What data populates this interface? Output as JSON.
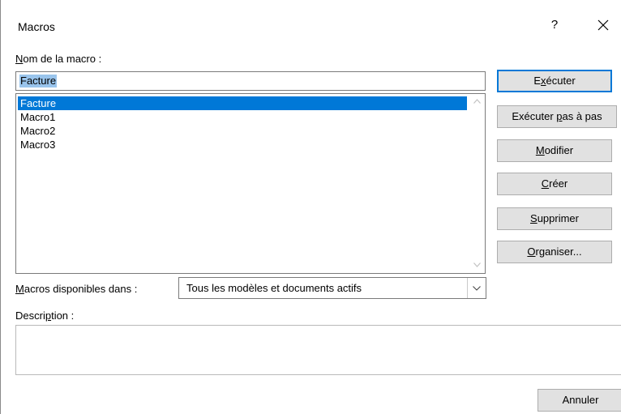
{
  "window": {
    "title": "Macros",
    "help_label": "?"
  },
  "macro_name": {
    "label_prefix": "",
    "label_access": "N",
    "label_rest": "om de la macro :",
    "value": "Facture"
  },
  "macro_list": {
    "items": [
      {
        "label": "Facture",
        "selected": true
      },
      {
        "label": "Macro1",
        "selected": false
      },
      {
        "label": "Macro2",
        "selected": false
      },
      {
        "label": "Macro3",
        "selected": false
      }
    ]
  },
  "available_in": {
    "label_prefix": "",
    "label_access": "M",
    "label_rest": "acros disponibles dans :",
    "selected_value": "Tous les modèles et documents actifs"
  },
  "description": {
    "label_prefix": "Descri",
    "label_access": "p",
    "label_rest": "tion :",
    "value": ""
  },
  "buttons": {
    "run": {
      "prefix": "E",
      "access": "x",
      "rest": "écuter"
    },
    "step": {
      "prefix": "Exécuter ",
      "access": "p",
      "rest": "as à pas"
    },
    "edit": {
      "prefix": "",
      "access": "M",
      "rest": "odifier"
    },
    "create": {
      "prefix": "",
      "access": "C",
      "rest": "réer"
    },
    "delete": {
      "prefix": "",
      "access": "S",
      "rest": "upprimer"
    },
    "organize": {
      "prefix": "",
      "access": "O",
      "rest": "rganiser..."
    },
    "cancel": {
      "label": "Annuler"
    }
  },
  "colors": {
    "selection_blue": "#0078d7",
    "text_highlight": "#99c4ec",
    "button_face": "#e1e1e1"
  }
}
